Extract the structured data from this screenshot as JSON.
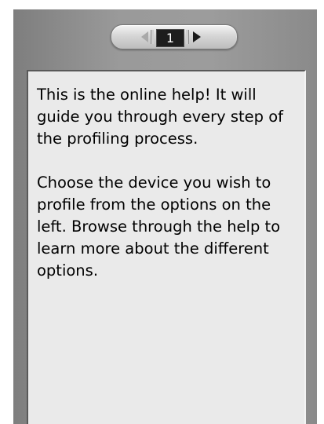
{
  "pager": {
    "current_page": "1",
    "prev_icon": "triangle-left-icon",
    "next_icon": "triangle-right-icon"
  },
  "help": {
    "paragraph1": "This is the online help! It will guide you through every step of the profiling process.",
    "paragraph2": "Choose the device you wish to profile from the options on the left. Browse through the help to learn more about the different options."
  },
  "colors": {
    "panel": "#9a9a9a",
    "help_background": "#eaeaea",
    "page_indicator": "#1d1d1d"
  }
}
